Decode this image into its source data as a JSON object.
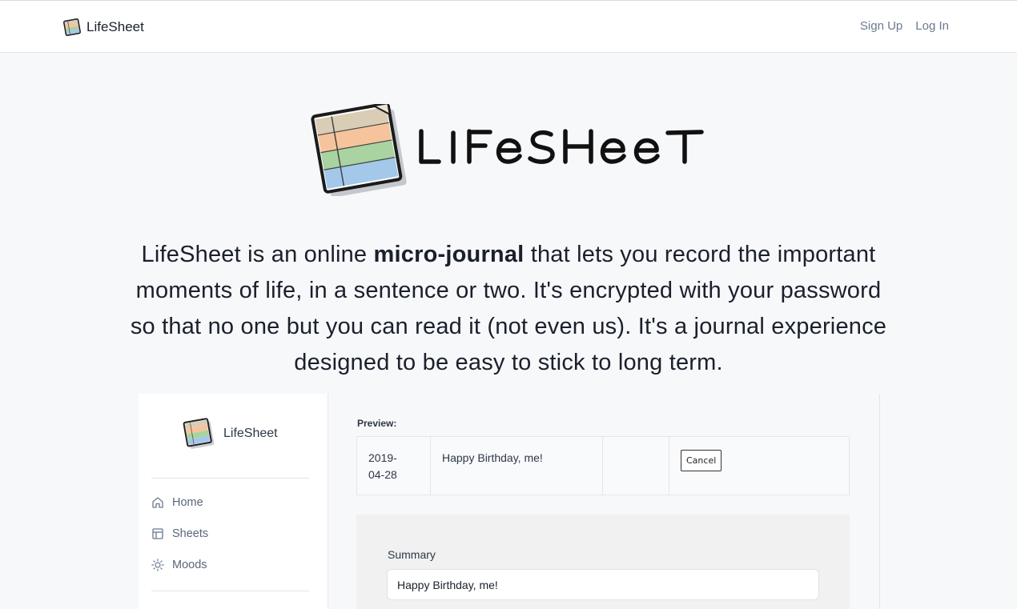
{
  "topbar": {
    "brand_name": "LifeSheet",
    "sign_up": "Sign Up",
    "log_in": "Log In"
  },
  "hero": {
    "logo_wordmark": "LIFeSHeeT",
    "text_before": "LifeSheet is an online ",
    "text_bold": "micro-journal",
    "text_after": " that lets you record the important moments of life, in a sentence or two. It's encrypted with your password so that no one but you can read it (not even us). It's a journal experience designed to be easy to stick to long term."
  },
  "app_preview": {
    "sidebar": {
      "brand_name": "LifeSheet",
      "items": [
        {
          "label": "Home",
          "icon": "home-icon"
        },
        {
          "label": "Sheets",
          "icon": "table-icon"
        },
        {
          "label": "Moods",
          "icon": "sun-icon"
        }
      ]
    },
    "preview_label": "Preview:",
    "row": {
      "date_line1": "2019-",
      "date_line2": "04-28",
      "summary": "Happy Birthday, me!",
      "cancel_label": "Cancel"
    },
    "form": {
      "summary_label": "Summary",
      "summary_value": "Happy Birthday, me!"
    }
  },
  "colors": {
    "sheet_tan": "#d9cdb6",
    "sheet_orange": "#f6c49c",
    "sheet_green": "#a9d3a0",
    "sheet_blue": "#a4c8ea",
    "nav_link": "#6b7a90",
    "page_bg": "#f7f8fa"
  }
}
